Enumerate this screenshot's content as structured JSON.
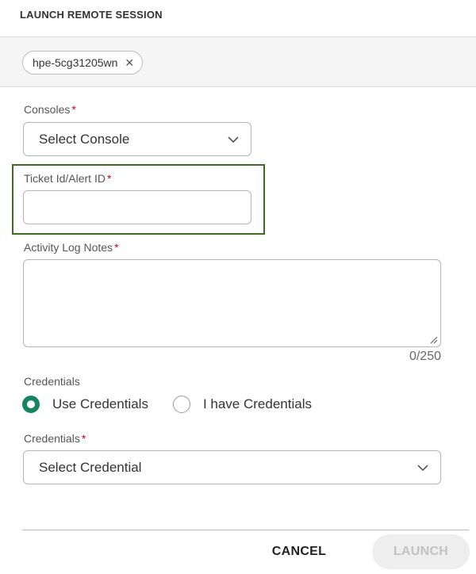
{
  "dialog": {
    "title": "LAUNCH REMOTE SESSION"
  },
  "device": {
    "chip_label": "hpe-5cg31205wn",
    "close_glyph": "✕",
    "close_icon": "close-icon"
  },
  "form": {
    "consoles": {
      "label": "Consoles",
      "required_mark": "*",
      "selected": "Select Console",
      "icon": "chevron-down-icon"
    },
    "ticket": {
      "label": "Ticket Id/Alert ID",
      "required_mark": "*",
      "value": "",
      "highlight_color": "#3d6b1f"
    },
    "activity_log": {
      "label": "Activity Log Notes",
      "required_mark": "*",
      "value": "",
      "counter": "0/250"
    },
    "credentials_mode": {
      "label": "Credentials",
      "options": [
        {
          "label": "Use Credentials",
          "checked": true
        },
        {
          "label": "I have Credentials",
          "checked": false
        }
      ],
      "accent_color": "#168460"
    },
    "credentials": {
      "label": "Credentials",
      "required_mark": "*",
      "selected": "Select Credential",
      "icon": "chevron-down-icon"
    }
  },
  "footer": {
    "cancel_label": "CANCEL",
    "launch_label": "LAUNCH"
  },
  "colors": {
    "required": "#d0021b",
    "launch_disabled_bg": "#eeeeee",
    "launch_disabled_text": "#c2c2c2"
  }
}
